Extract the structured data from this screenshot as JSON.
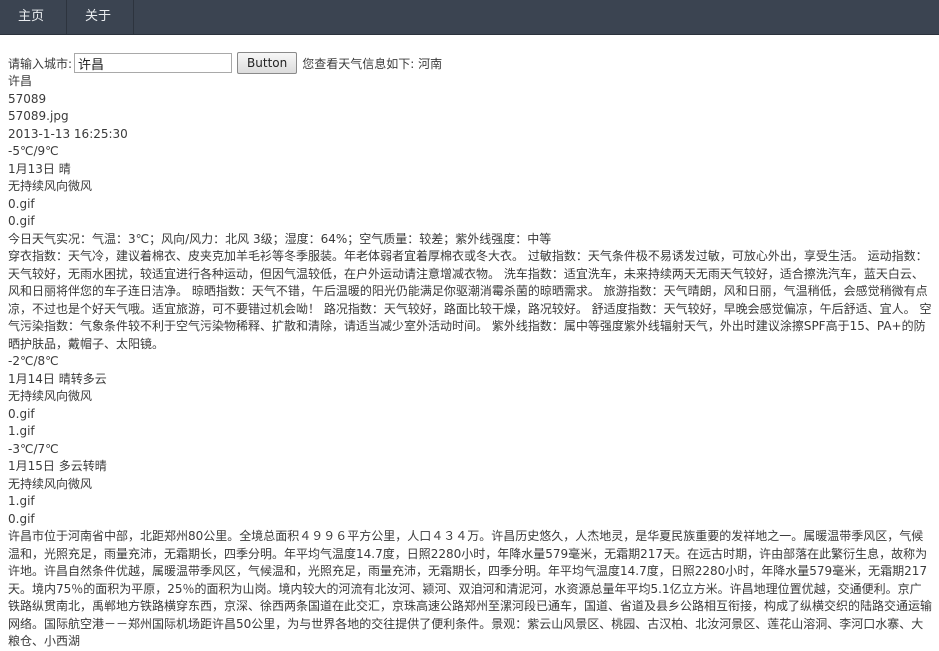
{
  "nav": {
    "home": "主页",
    "about": "关于"
  },
  "search": {
    "label": "请输入城市:",
    "value": "许昌",
    "button": "Button",
    "result_text": "您查看天气信息如下: 河南"
  },
  "weather": {
    "city": "许昌",
    "code": "57089",
    "image": "57089.jpg",
    "updated": "2013-1-13 16:25:30",
    "days": [
      {
        "temp": "-5℃/9℃",
        "desc": "1月13日 晴",
        "wind": "无持续风向微风",
        "icon1": "0.gif",
        "icon2": "0.gif"
      },
      {
        "temp": "-2℃/8℃",
        "desc": "1月14日 晴转多云",
        "wind": "无持续风向微风",
        "icon1": "0.gif",
        "icon2": "1.gif"
      },
      {
        "temp": "-3℃/7℃",
        "desc": "1月15日 多云转晴",
        "wind": "无持续风向微风",
        "icon1": "1.gif",
        "icon2": "0.gif"
      }
    ],
    "live": "今日天气实况：气温：3℃；风向/风力：北风 3级；湿度：64%；空气质量：较差；紫外线强度：中等",
    "indices": "穿衣指数：天气冷，建议着棉衣、皮夹克加羊毛衫等冬季服装。年老体弱者宜着厚棉衣或冬大衣。 过敏指数：天气条件极不易诱发过敏，可放心外出，享受生活。 运动指数：天气较好，无雨水困扰，较适宜进行各种运动，但因气温较低，在户外运动请注意增减衣物。 洗车指数：适宜洗车，未来持续两天无雨天气较好，适合擦洗汽车，蓝天白云、风和日丽将伴您的车子连日洁净。 晾晒指数：天气不错，午后温暖的阳光仍能满足你驱潮消霉杀菌的晾晒需求。 旅游指数：天气晴朗，风和日丽，气温稍低，会感觉稍微有点凉，不过也是个好天气哦。适宜旅游，可不要错过机会呦！ 路况指数：天气较好，路面比较干燥，路况较好。 舒适度指数：天气较好，早晚会感觉偏凉，午后舒适、宜人。 空气污染指数：气象条件较不利于空气污染物稀释、扩散和清除，请适当减少室外活动时间。 紫外线指数：属中等强度紫外线辐射天气，外出时建议涂擦SPF高于15、PA+的防晒护肤品，戴帽子、太阳镜。",
    "intro": "许昌市位于河南省中部，北距郑州80公里。全境总面积４９９６平方公里，人口４３４万。许昌历史悠久，人杰地灵，是华夏民族重要的发祥地之一。属暖温带季风区，气候温和，光照充足，雨量充沛，无霜期长，四季分明。年平均气温度14.7度，日照2280小时，年降水量579毫米，无霜期217天。在远古时期，许由部落在此繁衍生息，故称为许地。许昌自然条件优越，属暖温带季风区，气候温和，光照充足，雨量充沛，无霜期长，四季分明。年平均气温度14.7度，日照2280小时，年降水量579毫米，无霜期217天。境内75％的面积为平原，25％的面积为山岗。境内较大的河流有北汝河、颍河、双洎河和清泥河，水资源总量年平均5.1亿立方米。许昌地理位置优越，交通便利。京广铁路纵贯南北，禹郸地方铁路横穿东西，京深、徐西两条国道在此交汇，京珠高速公路郑州至漯河段已通车，国道、省道及县乡公路相互衔接，构成了纵横交织的陆路交通运输网络。国际航空港－－郑州国际机场距许昌50公里，为与世界各地的交往提供了便利条件。景观：紫云山风景区、桃园、古汉柏、北汝河景区、莲花山溶洞、李河口水寨、大粮仓、小西湖"
  }
}
